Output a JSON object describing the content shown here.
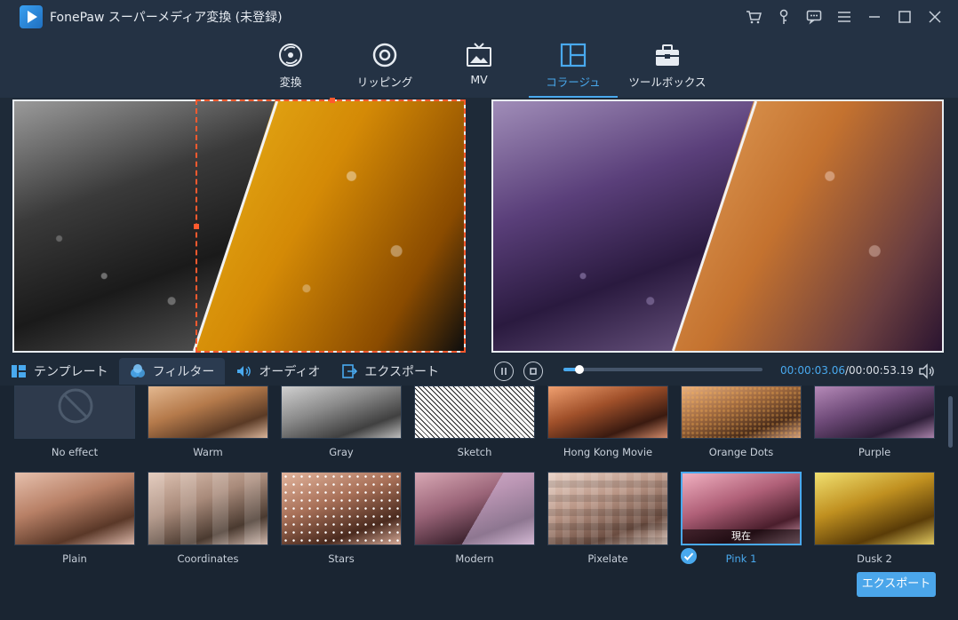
{
  "app": {
    "title": "FonePaw スーパーメディア変換 (未登録)"
  },
  "nav": [
    {
      "label": "変換",
      "icon": "convert-icon"
    },
    {
      "label": "リッピング",
      "icon": "disc-icon"
    },
    {
      "label": "MV",
      "icon": "tv-icon"
    },
    {
      "label": "コラージュ",
      "icon": "collage-icon",
      "active": true
    },
    {
      "label": "ツールボックス",
      "icon": "toolbox-icon"
    }
  ],
  "tabs": [
    {
      "label": "テンプレート",
      "icon": "template-icon"
    },
    {
      "label": "フィルター",
      "icon": "filter-icon",
      "active": true
    },
    {
      "label": "オーディオ",
      "icon": "audio-icon"
    },
    {
      "label": "エクスポート",
      "icon": "export-icon"
    }
  ],
  "player": {
    "current_time": "00:00:03.06",
    "total_time": "/00:00:53.19",
    "progress": 0.08
  },
  "filters": {
    "row1": [
      "No effect",
      "Warm",
      "Gray",
      "Sketch",
      "Hong Kong Movie",
      "Orange Dots",
      "Purple"
    ],
    "row2": [
      "Plain",
      "Coordinates",
      "Stars",
      "Modern",
      "Pixelate",
      "Pink 1",
      "Dusk 2"
    ],
    "current_badge": "現在",
    "current": "Pink 1"
  },
  "export_button": "エクスポート",
  "colors": {
    "accent": "#49a9ee",
    "selection": "#ff5a2e",
    "bg": "#1e2a38"
  }
}
